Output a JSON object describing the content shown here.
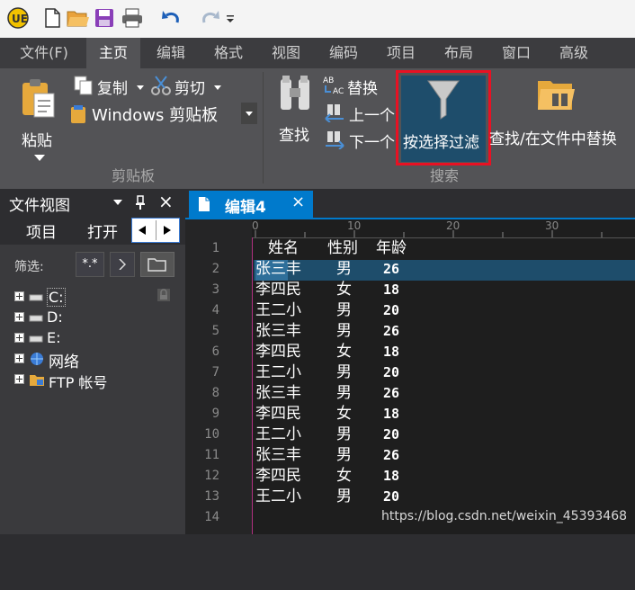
{
  "toolbar": {
    "icons": [
      "app-logo-icon",
      "new-file-icon",
      "open-folder-icon",
      "save-icon",
      "print-icon",
      "undo-icon",
      "redo-icon",
      "dropdown-icon"
    ]
  },
  "menu": {
    "tabs": [
      "文件(F)",
      "主页",
      "编辑",
      "格式",
      "视图",
      "编码",
      "项目",
      "布局",
      "窗口",
      "高级"
    ],
    "active": "主页"
  },
  "ribbon": {
    "clipboard": {
      "paste": "粘贴",
      "copy": "复制",
      "cut": "剪切",
      "clipboard_select": "Windows 剪贴板",
      "group_label": "剪贴板"
    },
    "search": {
      "find": "查找",
      "replace": "替换",
      "prev": "上一个",
      "next": "下一个",
      "filter": "按选择过滤",
      "find_in_files": "查找/在文件中替换",
      "group_label": "搜索"
    }
  },
  "file_view": {
    "title": "文件视图",
    "pin": "ᵖ",
    "close": "×",
    "tabs": [
      "项目",
      "打开"
    ],
    "filter_label": "筛选:",
    "filter_value": "*.*",
    "tree": [
      "C:",
      "D:",
      "E:",
      "网络",
      "FTP 帐号"
    ]
  },
  "editor": {
    "tab_title": "编辑4",
    "ruler": [
      "0",
      "10",
      "20",
      "30"
    ],
    "line_numbers": [
      "1",
      "2",
      "3",
      "4",
      "5",
      "6",
      "7",
      "8",
      "9",
      "10",
      "11",
      "12",
      "13",
      "14"
    ],
    "header": [
      "姓名",
      "性别",
      "年龄"
    ],
    "rows": [
      [
        "张三丰",
        "男",
        "26"
      ],
      [
        "李四民",
        "女",
        "18"
      ],
      [
        "王二小",
        "男",
        "20"
      ],
      [
        "张三丰",
        "男",
        "26"
      ],
      [
        "李四民",
        "女",
        "18"
      ],
      [
        "王二小",
        "男",
        "20"
      ],
      [
        "张三丰",
        "男",
        "26"
      ],
      [
        "李四民",
        "女",
        "18"
      ],
      [
        "王二小",
        "男",
        "20"
      ],
      [
        "张三丰",
        "男",
        "26"
      ],
      [
        "李四民",
        "女",
        "18"
      ],
      [
        "王二小",
        "男",
        "20"
      ]
    ],
    "selection": "张三",
    "watermark": "https://blog.csdn.net/weixin_45393468"
  },
  "colors": {
    "accent": "#007acc",
    "highlight_box": "#e81123",
    "selected_line": "#1e4d6b"
  }
}
